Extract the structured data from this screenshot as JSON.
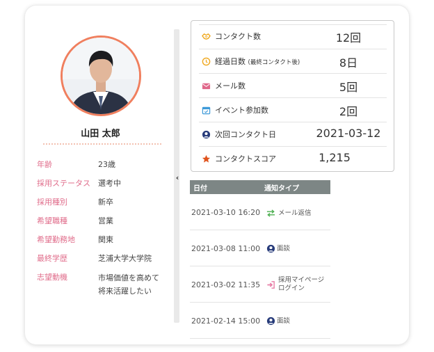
{
  "profile": {
    "name": "山田 太郎",
    "fields": [
      {
        "label": "年齢",
        "value": "23歳"
      },
      {
        "label": "採用ステータス",
        "value": "選考中"
      },
      {
        "label": "採用種別",
        "value": "新卒"
      },
      {
        "label": "希望職種",
        "value": "営業"
      },
      {
        "label": "希望勤務地",
        "value": "関東"
      },
      {
        "label": "最終学歴",
        "value": "芝浦大学大学院"
      },
      {
        "label": "志望動機",
        "value": "市場価値を高めて将来活躍したい",
        "value_line1": "市場価値を高めて",
        "value_line2": "将来活躍したい"
      }
    ]
  },
  "stats": [
    {
      "icon": "handshake-icon",
      "label": "コンタクト数",
      "value": "12回"
    },
    {
      "icon": "clock-icon",
      "label": "経過日数",
      "label_small": "(最終コンタクト後)",
      "value": "8日"
    },
    {
      "icon": "mail-icon",
      "label": "メール数",
      "value": "5回"
    },
    {
      "icon": "calendar-icon",
      "label": "イベント参加数",
      "value": "2回"
    },
    {
      "icon": "user-circle-icon",
      "label": "次回コンタクト日",
      "value": "2021-03-12"
    },
    {
      "icon": "star-icon",
      "label": "コンタクトスコア",
      "value": "1,215"
    }
  ],
  "history": {
    "headers": {
      "date": "日付",
      "type": "通知タイプ"
    },
    "rows": [
      {
        "date": "2021-03-10 16:20",
        "icon": "exchange-arrows-icon",
        "type": "メール返信"
      },
      {
        "date": "2021-03-08 11:00",
        "icon": "user-circle-icon",
        "type": "面談"
      },
      {
        "date": "2021-03-02 11:35",
        "icon": "sign-in-icon",
        "type_line1": "採用マイページ",
        "type_line2": "ログイン",
        "type": "採用マイページログイン"
      },
      {
        "date": "2021-02-14 15:00",
        "icon": "user-circle-icon",
        "type": "面談"
      }
    ]
  },
  "colors": {
    "accent_label": "#e06d8b",
    "avatar_border": "#f07f5e",
    "table_header": "#7d8685",
    "star": "#e0531c",
    "mail": "#e0678a",
    "calendar": "#3d9ad9",
    "clock": "#f0a81e",
    "user_icon": "#273b7a",
    "reply_arrows": "#4caf50",
    "login_icon": "#e87ea7"
  },
  "collapse_glyph": "‹"
}
